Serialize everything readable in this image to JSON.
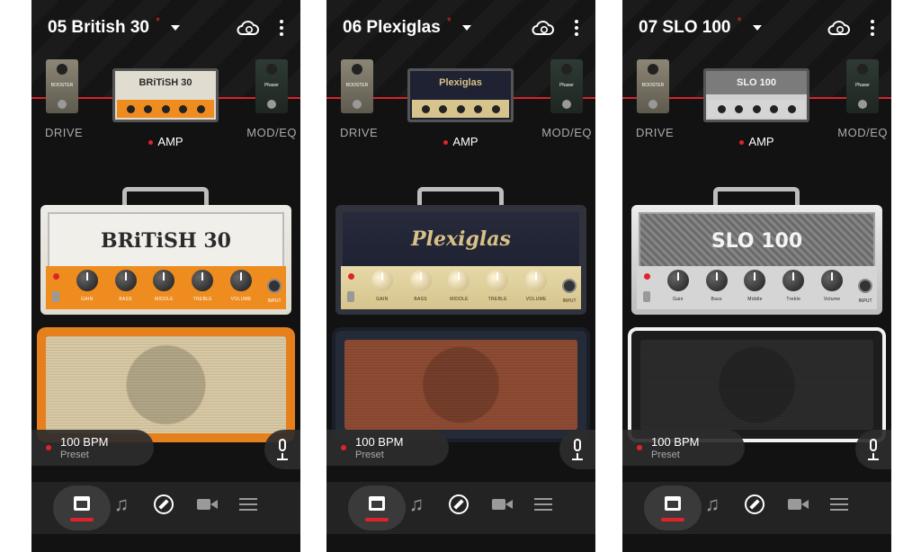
{
  "panels": [
    {
      "preset_title": "05 British 30",
      "modified_mark": "*",
      "slots": {
        "drive": "DRIVE",
        "amp": "AMP",
        "mod_eq": "MOD/EQ"
      },
      "drive_pedal_text": "BOOSTER",
      "mod_pedal_text": "Phaser",
      "amp_name": "BRiTiSH 30",
      "knob_labels": [
        "GAIN",
        "BASS",
        "MIDDLE",
        "TREBLE",
        "VOLUME"
      ],
      "input_label": "INPUT",
      "tempo": "100 BPM",
      "tempo_mode": "Preset",
      "colors": {
        "faceplate": "#e1dcd0",
        "panel": "#ee8c20",
        "knob": "#1a1a1a",
        "cab_tolex": "#e5801d",
        "grill": "#d8c9a4"
      }
    },
    {
      "preset_title": "06 Plexiglas",
      "modified_mark": "*",
      "slots": {
        "drive": "DRIVE",
        "amp": "AMP",
        "mod_eq": "MOD/EQ"
      },
      "drive_pedal_text": "BOOSTER",
      "mod_pedal_text": "Phaser",
      "amp_name": "Plexiglas",
      "knob_labels": [
        "GAIN",
        "BASS",
        "MIDDLE",
        "TREBLE",
        "VOLUME"
      ],
      "input_label": "INPUT",
      "tempo": "100 BPM",
      "tempo_mode": "Preset",
      "colors": {
        "faceplate": "#1e2233",
        "panel": "#d7c48d",
        "knob": "#c4b079",
        "cab_tolex": "#252a38",
        "grill": "#8e4b33"
      }
    },
    {
      "preset_title": "07 SLO 100",
      "modified_mark": "*",
      "slots": {
        "drive": "DRIVE",
        "amp": "AMP",
        "mod_eq": "MOD/EQ"
      },
      "drive_pedal_text": "BOOSTER",
      "mod_pedal_text": "Phaser",
      "amp_name": "SLO 100",
      "knob_labels": [
        "Gain",
        "Bass",
        "Middle",
        "Treble",
        "Volume"
      ],
      "input_label": "INPUT",
      "tempo": "100 BPM",
      "tempo_mode": "Preset",
      "colors": {
        "faceplate": "#7b7b7b",
        "panel": "#d5d5d5",
        "knob": "#1e1e1e",
        "cab_tolex": "#e3e3de",
        "grill": "#2b2b2b"
      }
    }
  ],
  "nav_icons": [
    "amp-icon",
    "music-note-icon",
    "tuner-icon",
    "video-camera-icon",
    "menu-icon"
  ]
}
